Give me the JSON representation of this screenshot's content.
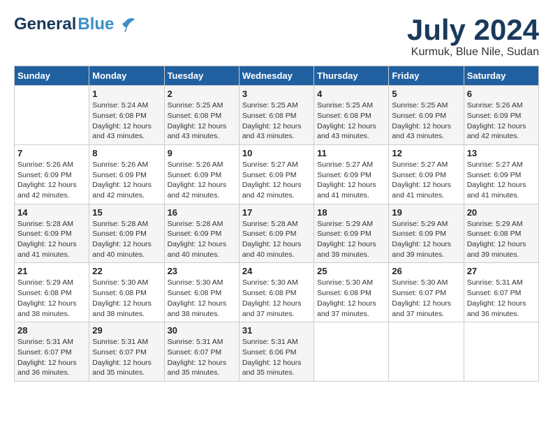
{
  "header": {
    "logo_general": "General",
    "logo_blue": "Blue",
    "month_title": "July 2024",
    "location": "Kurmuk, Blue Nile, Sudan"
  },
  "weekdays": [
    "Sunday",
    "Monday",
    "Tuesday",
    "Wednesday",
    "Thursday",
    "Friday",
    "Saturday"
  ],
  "weeks": [
    [
      {
        "day": "",
        "info": ""
      },
      {
        "day": "1",
        "info": "Sunrise: 5:24 AM\nSunset: 6:08 PM\nDaylight: 12 hours\nand 43 minutes."
      },
      {
        "day": "2",
        "info": "Sunrise: 5:25 AM\nSunset: 6:08 PM\nDaylight: 12 hours\nand 43 minutes."
      },
      {
        "day": "3",
        "info": "Sunrise: 5:25 AM\nSunset: 6:08 PM\nDaylight: 12 hours\nand 43 minutes."
      },
      {
        "day": "4",
        "info": "Sunrise: 5:25 AM\nSunset: 6:08 PM\nDaylight: 12 hours\nand 43 minutes."
      },
      {
        "day": "5",
        "info": "Sunrise: 5:25 AM\nSunset: 6:09 PM\nDaylight: 12 hours\nand 43 minutes."
      },
      {
        "day": "6",
        "info": "Sunrise: 5:26 AM\nSunset: 6:09 PM\nDaylight: 12 hours\nand 42 minutes."
      }
    ],
    [
      {
        "day": "7",
        "info": "Sunrise: 5:26 AM\nSunset: 6:09 PM\nDaylight: 12 hours\nand 42 minutes."
      },
      {
        "day": "8",
        "info": "Sunrise: 5:26 AM\nSunset: 6:09 PM\nDaylight: 12 hours\nand 42 minutes."
      },
      {
        "day": "9",
        "info": "Sunrise: 5:26 AM\nSunset: 6:09 PM\nDaylight: 12 hours\nand 42 minutes."
      },
      {
        "day": "10",
        "info": "Sunrise: 5:27 AM\nSunset: 6:09 PM\nDaylight: 12 hours\nand 42 minutes."
      },
      {
        "day": "11",
        "info": "Sunrise: 5:27 AM\nSunset: 6:09 PM\nDaylight: 12 hours\nand 41 minutes."
      },
      {
        "day": "12",
        "info": "Sunrise: 5:27 AM\nSunset: 6:09 PM\nDaylight: 12 hours\nand 41 minutes."
      },
      {
        "day": "13",
        "info": "Sunrise: 5:27 AM\nSunset: 6:09 PM\nDaylight: 12 hours\nand 41 minutes."
      }
    ],
    [
      {
        "day": "14",
        "info": "Sunrise: 5:28 AM\nSunset: 6:09 PM\nDaylight: 12 hours\nand 41 minutes."
      },
      {
        "day": "15",
        "info": "Sunrise: 5:28 AM\nSunset: 6:09 PM\nDaylight: 12 hours\nand 40 minutes."
      },
      {
        "day": "16",
        "info": "Sunrise: 5:28 AM\nSunset: 6:09 PM\nDaylight: 12 hours\nand 40 minutes."
      },
      {
        "day": "17",
        "info": "Sunrise: 5:28 AM\nSunset: 6:09 PM\nDaylight: 12 hours\nand 40 minutes."
      },
      {
        "day": "18",
        "info": "Sunrise: 5:29 AM\nSunset: 6:09 PM\nDaylight: 12 hours\nand 39 minutes."
      },
      {
        "day": "19",
        "info": "Sunrise: 5:29 AM\nSunset: 6:09 PM\nDaylight: 12 hours\nand 39 minutes."
      },
      {
        "day": "20",
        "info": "Sunrise: 5:29 AM\nSunset: 6:08 PM\nDaylight: 12 hours\nand 39 minutes."
      }
    ],
    [
      {
        "day": "21",
        "info": "Sunrise: 5:29 AM\nSunset: 6:08 PM\nDaylight: 12 hours\nand 38 minutes."
      },
      {
        "day": "22",
        "info": "Sunrise: 5:30 AM\nSunset: 6:08 PM\nDaylight: 12 hours\nand 38 minutes."
      },
      {
        "day": "23",
        "info": "Sunrise: 5:30 AM\nSunset: 6:08 PM\nDaylight: 12 hours\nand 38 minutes."
      },
      {
        "day": "24",
        "info": "Sunrise: 5:30 AM\nSunset: 6:08 PM\nDaylight: 12 hours\nand 37 minutes."
      },
      {
        "day": "25",
        "info": "Sunrise: 5:30 AM\nSunset: 6:08 PM\nDaylight: 12 hours\nand 37 minutes."
      },
      {
        "day": "26",
        "info": "Sunrise: 5:30 AM\nSunset: 6:07 PM\nDaylight: 12 hours\nand 37 minutes."
      },
      {
        "day": "27",
        "info": "Sunrise: 5:31 AM\nSunset: 6:07 PM\nDaylight: 12 hours\nand 36 minutes."
      }
    ],
    [
      {
        "day": "28",
        "info": "Sunrise: 5:31 AM\nSunset: 6:07 PM\nDaylight: 12 hours\nand 36 minutes."
      },
      {
        "day": "29",
        "info": "Sunrise: 5:31 AM\nSunset: 6:07 PM\nDaylight: 12 hours\nand 35 minutes."
      },
      {
        "day": "30",
        "info": "Sunrise: 5:31 AM\nSunset: 6:07 PM\nDaylight: 12 hours\nand 35 minutes."
      },
      {
        "day": "31",
        "info": "Sunrise: 5:31 AM\nSunset: 6:06 PM\nDaylight: 12 hours\nand 35 minutes."
      },
      {
        "day": "",
        "info": ""
      },
      {
        "day": "",
        "info": ""
      },
      {
        "day": "",
        "info": ""
      }
    ]
  ]
}
